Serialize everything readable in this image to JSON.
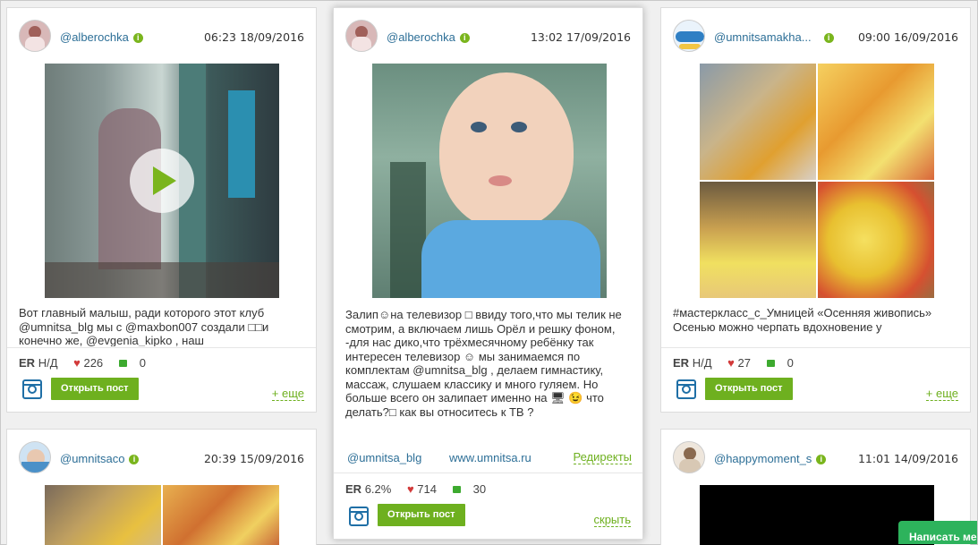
{
  "posts": [
    {
      "handle": "@alberochka",
      "date": "06:23 18/09/2016",
      "caption": "Вот главный малыш, ради которого этот клуб @umnitsa_blg мы с @maxbon007 создали □□и конечно же, @evgenia_kipko , наш",
      "er_label": "ER",
      "er_value": "Н/Д",
      "likes": "226",
      "comments": "0",
      "open_label": "Открыть пост",
      "more_label": "+ еще",
      "avatar_icon": "user-avatar-icon",
      "media_type": "video"
    },
    {
      "handle": "@alberochka",
      "date": "13:02 17/09/2016",
      "caption": "Залип☺на телевизор □ ввиду того,что мы телик не смотрим, а включаем лишь Орёл и решку фоном, -для нас дико,что трёхмесячному ребёнку так интересен телевизор ☺ мы занимаемся по комплектам @umnitsa_blg , делаем гимнастику, массаж, слушаем классику и много гуляем. Но больше всего он залипает именно на 🖥 😉 что делать?□ как вы относитесь к ТВ ?",
      "link1": "@umnitsa_blg",
      "link2": "www.umnitsa.ru",
      "link3": "Редиректы",
      "er_label": "ER",
      "er_value": "6.2%",
      "likes": "714",
      "comments": "30",
      "open_label": "Открыть пост",
      "more_label": "скрыть",
      "avatar_icon": "user-avatar-icon",
      "media_type": "photo"
    },
    {
      "handle": "@umnitsamakha...",
      "date": "09:00 16/09/2016",
      "caption": "#мастеркласс_с_Умницей «Осенняя живопись» Осенью можно черпать вдохновение у",
      "er_label": "ER",
      "er_value": "Н/Д",
      "likes": "27",
      "comments": "0",
      "open_label": "Открыть пост",
      "more_label": "+ еще",
      "avatar_icon": "brand-avatar-icon",
      "media_type": "collage"
    },
    {
      "handle": "@umnitsaco",
      "date": "20:39 15/09/2016",
      "avatar_icon": "brand-avatar-icon",
      "media_type": "collage"
    },
    {
      "handle": "@happymoment_s",
      "date": "11:01 14/09/2016",
      "avatar_icon": "user-avatar-icon",
      "media_type": "video"
    }
  ],
  "chat": {
    "label": "Написать ме"
  },
  "colors": {
    "accent": "#6eb01f",
    "link": "#2d6f97",
    "heart": "#d23a3a",
    "comment": "#3daa2f"
  }
}
